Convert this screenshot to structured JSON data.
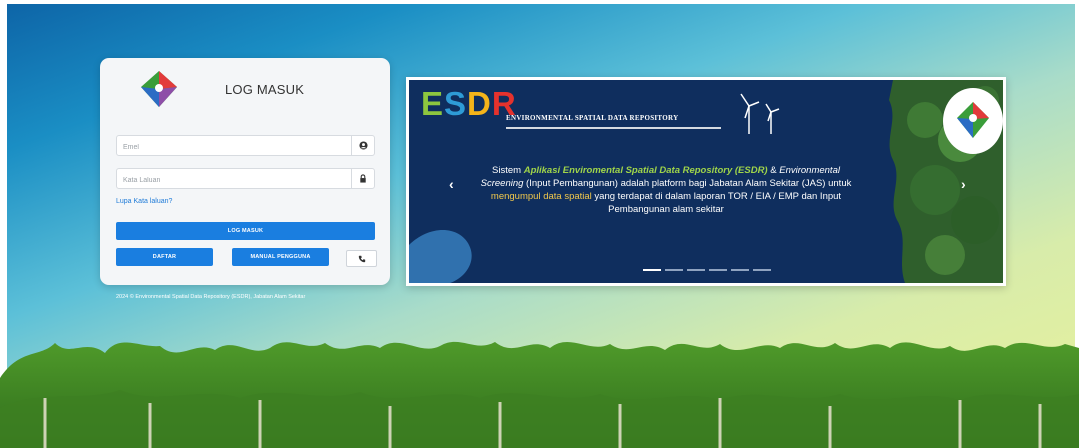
{
  "login": {
    "title": "LOG MASUK",
    "email_placeholder": "Emel",
    "password_placeholder": "Kata Laluan",
    "forgot_link": "Lupa Kata laluan?",
    "login_button": "LOG MASUK",
    "register_button": "DAFTAR",
    "manual_button": "MANUAL PENGGUNA"
  },
  "footer": {
    "copyright": "2024 © Environmental Spatial Data Repository (ESDR), Jabatan Alam Sekitar"
  },
  "banner": {
    "logo_e": "E",
    "logo_s": "S",
    "logo_d": "D",
    "logo_r": "R",
    "subtitle": "ENVIRONMENTAL SPATIAL DATA REPOSITORY",
    "text_1": "Sistem ",
    "text_2": "Aplikasi Enviromental Spatial Data Repository (ESDR)",
    "text_3": " & ",
    "text_4": "Environmental Screening",
    "text_5": " (Input Pembangunan) adalah platform bagi Jabatan Alam Sekitar (JAS) untuk ",
    "text_6": "mengumpul data spatial",
    "text_7": " yang terdapat di dalam laporan TOR / EIA / EMP dan Input Pembangunan alam sekitar",
    "prev_arrow": "‹",
    "next_arrow": "›",
    "slides_count": 6,
    "active_slide": 1
  },
  "icons": {
    "email": "user-circle-icon",
    "password": "lock-icon",
    "phone": "phone-icon"
  },
  "colors": {
    "primary_button": "#1a7ee0",
    "banner_bg": "#0f2e5e",
    "highlight_green": "#9fd44a",
    "highlight_yellow": "#f2c94c"
  }
}
